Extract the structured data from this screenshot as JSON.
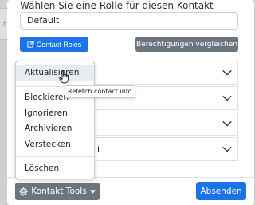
{
  "background": {
    "snippet": ".h"
  },
  "role": {
    "label": "Wählen Sie eine Rolle für diesen Kontakt",
    "selected": "Default"
  },
  "buttons": {
    "contact_roles": "Contact Roles",
    "compare_permissions": "Berechtigungen vergleichen",
    "kontakt_tools": "Kontakt Tools",
    "absenden": "Absenden"
  },
  "accordion": {
    "items": [
      {
        "label": ""
      },
      {
        "label": ""
      },
      {
        "label": ""
      },
      {
        "label": "t"
      }
    ]
  },
  "menu": {
    "items": [
      "Aktualisieren",
      "Blockieren",
      "Ignorieren",
      "Archivieren",
      "Verstecken",
      "Löschen"
    ]
  },
  "tooltip": {
    "text": "Refetch contact info"
  },
  "colors": {
    "primary": "#1a73e8",
    "secondary": "#6c757d"
  }
}
